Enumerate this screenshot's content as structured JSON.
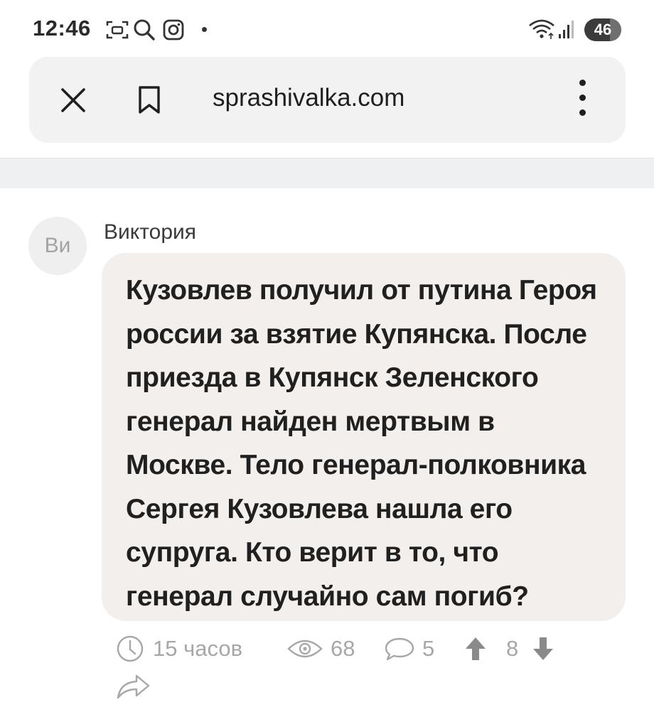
{
  "status_bar": {
    "time": "12:46",
    "battery": "46",
    "icons": [
      "screenshot-icon",
      "search-icon",
      "instagram-icon",
      "notification-dot-icon",
      "wifi-icon",
      "signal-icon",
      "battery-icon"
    ]
  },
  "address_bar": {
    "url": "sprashivalka.com",
    "icons": [
      "close-icon",
      "bookmark-icon",
      "more-vert-icon"
    ]
  },
  "post": {
    "avatar_initials": "Ви",
    "author": "Виктория",
    "text": "Кузовлев получил от путина Героя россии за взятие Купянска. После приезда в Купянск Зеленского генерал найден мертвым в Москве. Тело генерал-полковника Сергея Кузовлева нашла его супруга. Кто верит в то, что генерал случайно сам погиб?",
    "time_ago": "15 часов",
    "views": "68",
    "comments": "5",
    "score": "8"
  },
  "colors": {
    "bubble_bg": "#f3efec",
    "address_bg": "#f2f2f2",
    "meta_gray": "#a7a7a7",
    "band_bg": "#eef0f2"
  }
}
